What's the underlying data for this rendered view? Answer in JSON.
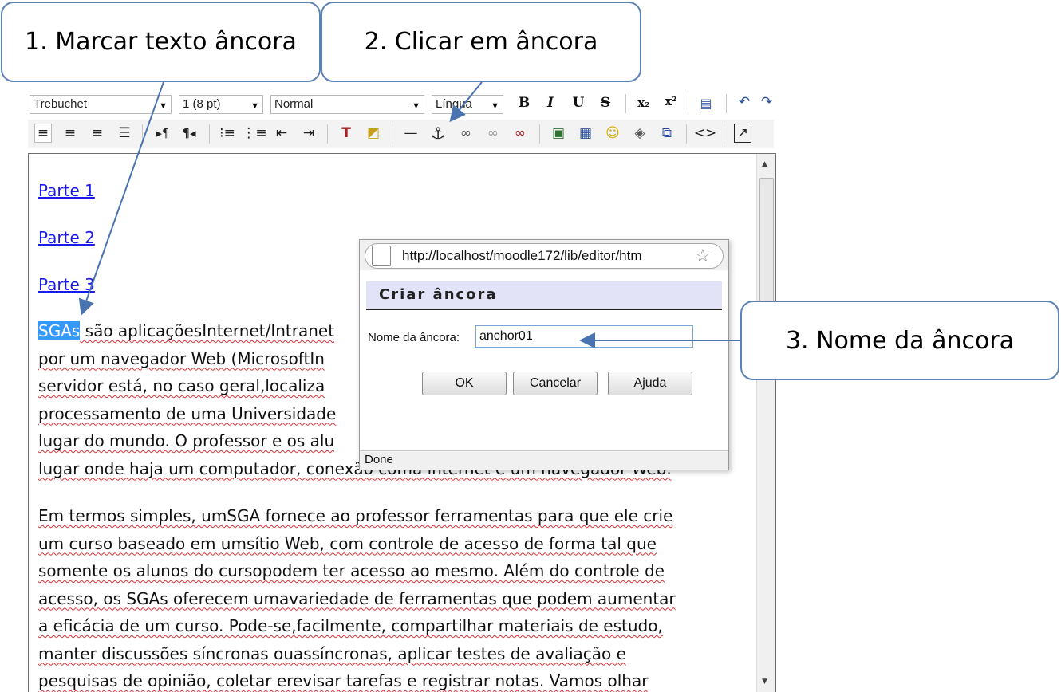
{
  "callouts": {
    "step1": "1. Marcar texto âncora",
    "step2": "2. Clicar em âncora",
    "step3": "3. Nome da âncora"
  },
  "toolbar": {
    "font": "Trebuchet",
    "size": "1 (8 pt)",
    "format": "Normal",
    "language": "Língua",
    "bold": "B",
    "italic": "I",
    "underline": "U",
    "strike": "S",
    "subscript": "x₂",
    "superscript": "x²"
  },
  "editor": {
    "links": [
      "Parte 1",
      "Parte 2",
      "Parte 3"
    ],
    "selected_text": "SGAs",
    "para1": [
      " são aplicaçõesInternet/Intranet",
      "por um navegador Web (MicrosoftIn",
      "servidor está, no caso geral,localiza",
      "processamento de uma Universidade",
      "lugar do mundo. O professor e os alu",
      "lugar onde haja um computador, conexão coma internet e um navegador Web."
    ],
    "para2": [
      "Em termos simples, umSGA fornece ao professor ferramentas para que ele crie",
      "um curso baseado em umsítio Web, com controle de acesso de forma tal que",
      "somente os alunos do cursopodem ter acesso ao mesmo. Além do controle de",
      "acesso, os SGAs oferecem umavariedade de ferramentas que podem aumentar",
      "a eficácia de um curso. Pode-se,facilmente, compartilhar materiais de estudo,",
      "manter discussões síncronas ouassíncronas, aplicar testes de avaliação e",
      "pesquisas de opinião, coletar erevisar tarefas e registrar notas. Vamos olhar"
    ]
  },
  "popup": {
    "url": "http://localhost/moodle172/lib/editor/htm",
    "title": "Criar âncora",
    "name_label": "Nome da âncora:",
    "name_value": "anchor01",
    "ok": "OK",
    "cancel": "Cancelar",
    "help": "Ajuda",
    "status": "Done"
  },
  "colors": {
    "callout_border": "#5b82b5",
    "link": "#1a1aee",
    "selection": "#3399ff",
    "dialog_title_bg": "#e3e3f8"
  }
}
